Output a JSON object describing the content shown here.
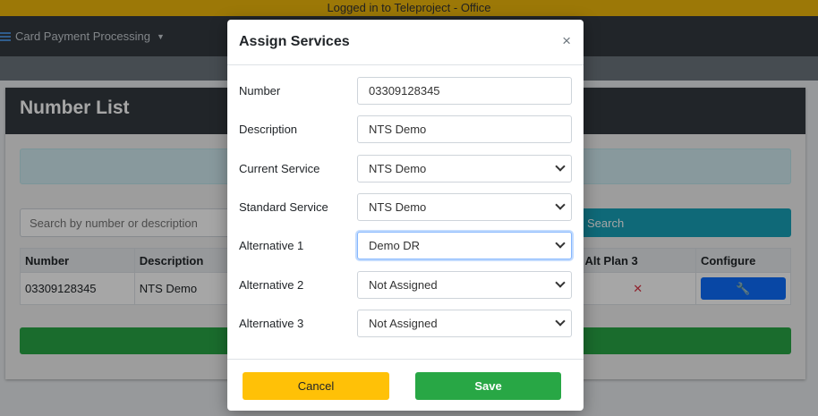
{
  "banner": {
    "text": "Logged in to Teleproject - Office"
  },
  "navbar": {
    "menu_label": "Card Payment Processing",
    "menu_icon": "menu-icon"
  },
  "page": {
    "title": "Number List",
    "search_placeholder": "Search by number or description",
    "search_button": "Search"
  },
  "table": {
    "headers": [
      "Number",
      "Description",
      "Alt Plan 3",
      "Configure"
    ],
    "rows": [
      {
        "number": "03309128345",
        "description": "NTS Demo",
        "alt_plan_3": "✕",
        "configure_icon": "wrench-icon"
      }
    ]
  },
  "modal": {
    "title": "Assign Services",
    "close": "×",
    "fields": [
      {
        "label": "Number",
        "value": "03309128345",
        "type": "text"
      },
      {
        "label": "Description",
        "value": "NTS Demo",
        "type": "text"
      },
      {
        "label": "Current Service",
        "value": "NTS Demo",
        "type": "select"
      },
      {
        "label": "Standard Service",
        "value": "NTS Demo",
        "type": "select"
      },
      {
        "label": "Alternative 1",
        "value": "Demo DR",
        "type": "select"
      },
      {
        "label": "Alternative 2",
        "value": "Not Assigned",
        "type": "select"
      },
      {
        "label": "Alternative 3",
        "value": "Not Assigned",
        "type": "select"
      }
    ],
    "cancel_label": "Cancel",
    "save_label": "Save"
  },
  "colors": {
    "banner": "#f0b90b",
    "navbar": "#343a40",
    "cancel": "#ffc107",
    "save": "#28a745",
    "configure": "#0d6efd",
    "search": "#17a2b8"
  }
}
